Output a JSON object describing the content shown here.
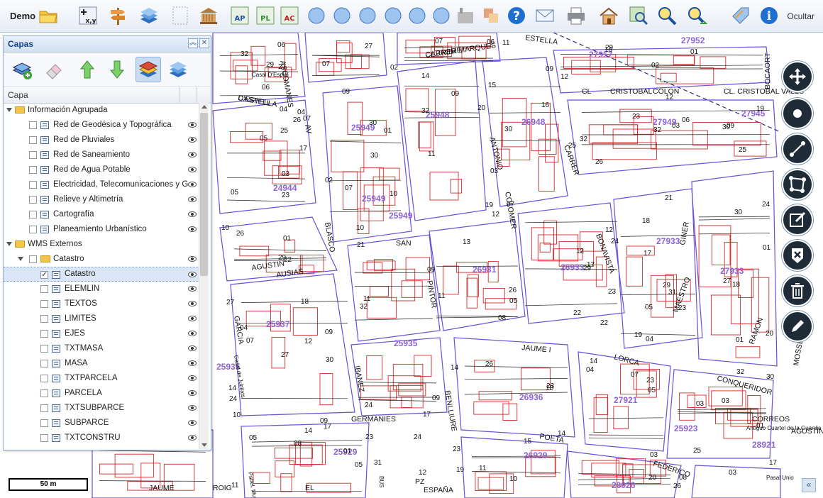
{
  "toolbar": {
    "title": "Demo",
    "hide_label": "Ocultar",
    "buttons": [
      {
        "name": "open-folder-icon"
      },
      {
        "name": "coordinates-icon",
        "text": "x,y"
      },
      {
        "name": "signpost-icon"
      },
      {
        "name": "layers-icon"
      },
      {
        "name": "blank-icon"
      },
      {
        "name": "building-icon"
      },
      {
        "name": "measure-ap-icon",
        "text": "AP"
      },
      {
        "name": "measure-pl-icon",
        "text": "PL"
      },
      {
        "name": "measure-ac-icon",
        "text": "AC"
      },
      {
        "name": "add-point-icon"
      },
      {
        "name": "add-line-icon"
      },
      {
        "name": "add-i-icon"
      },
      {
        "name": "add-v-icon"
      },
      {
        "name": "add-c-icon"
      },
      {
        "name": "add-u-icon"
      },
      {
        "name": "factory-icon"
      },
      {
        "name": "overlay-icon"
      },
      {
        "name": "help-icon"
      },
      {
        "name": "mail-icon"
      },
      {
        "name": "print-icon"
      },
      {
        "name": "home-icon"
      },
      {
        "name": "zoom-extent-icon"
      },
      {
        "name": "zoom-in-icon"
      },
      {
        "name": "zoom-next-icon"
      },
      {
        "name": "tag-icon"
      },
      {
        "name": "info-icon"
      }
    ]
  },
  "panel": {
    "title": "Capas",
    "column_header": "Capa",
    "groups": [
      {
        "label": "Información Agrupada",
        "children": [
          {
            "label": "Red de Geodésica y Topográfica",
            "checked": false
          },
          {
            "label": "Red de Pluviales",
            "checked": false
          },
          {
            "label": "Red de Saneamiento",
            "checked": false
          },
          {
            "label": "Red de Agua Potable",
            "checked": false
          },
          {
            "label": "Electricidad, Telecomunicaciones y G",
            "checked": false
          },
          {
            "label": "Relieve y Altimetría",
            "checked": false
          },
          {
            "label": "Cartografía",
            "checked": false
          },
          {
            "label": "Planeamiento Urbanístico",
            "checked": false
          }
        ]
      },
      {
        "label": "WMS Externos",
        "subgroup": "Catastro",
        "children": [
          {
            "label": "Catastro",
            "checked": true
          },
          {
            "label": "ELEMLIN",
            "checked": false
          },
          {
            "label": "TEXTOS",
            "checked": false
          },
          {
            "label": "LIMITES",
            "checked": false
          },
          {
            "label": "EJES",
            "checked": false
          },
          {
            "label": "TXTMASA",
            "checked": false
          },
          {
            "label": "MASA",
            "checked": false
          },
          {
            "label": "TXTPARCELA",
            "checked": false
          },
          {
            "label": "PARCELA",
            "checked": false
          },
          {
            "label": "TXTSUBPARCE",
            "checked": false
          },
          {
            "label": "SUBPARCE",
            "checked": false
          },
          {
            "label": "TXTCONSTRU",
            "checked": false
          }
        ]
      }
    ]
  },
  "map": {
    "scale_label": "50 m",
    "street_labels": [
      "CARRER MARQUES",
      "D'ESTELLA",
      "ESTELLA",
      "ASCOMANES",
      "CL",
      "CRISTOBAL",
      "COLON",
      "CL. CRISTOBAL VALLS",
      "BOCAORT",
      "AGUSTIN",
      "SAN",
      "BLASCO",
      "ANTONIO",
      "COLOMER",
      "CARRER",
      "AV",
      "JAUME I",
      "BONAVISTA",
      "GINER",
      "MAESTRO",
      "RAMON",
      "MOSSEN",
      "CONQUERIDOR",
      "CORREOS",
      "PINTOR",
      "BENLLIURE",
      "IBANEZ",
      "GERMANIES",
      "POETA",
      "FEDERICO",
      "PZ",
      "ESPAÑA",
      "JAUME",
      "ROIG",
      "GARCIA",
      "LORCA",
      "AUSIAS",
      "EL",
      "AGUSTÍN",
      "CL JAUME",
      "CASTELL"
    ],
    "block_numbers": [
      "27957",
      "27952",
      "25948",
      "26948",
      "25949",
      "27949",
      "27945",
      "24944",
      "25949",
      "25949",
      "27933",
      "26931",
      "26933",
      "27933",
      "25937",
      "25935",
      "26936",
      "27921",
      "25923",
      "28921",
      "25929",
      "26929",
      "28928",
      "25935"
    ],
    "parcel_numbers": [
      "01",
      "02",
      "03",
      "04",
      "05",
      "06",
      "07",
      "08",
      "09",
      "10",
      "11",
      "12",
      "13",
      "14",
      "15",
      "16",
      "17",
      "18",
      "19",
      "20",
      "21",
      "22",
      "23",
      "24",
      "25",
      "26",
      "27",
      "28",
      "29",
      "30",
      "31",
      "32"
    ],
    "annotations": [
      "Casal D'Esplai",
      "Pabel. Munic",
      "Casal de Jubilats",
      "Antiguo Cuartel de la Guardia Civil",
      "Pasal Unio",
      "BUS"
    ]
  },
  "right_tools": [
    {
      "name": "pan-tool-icon"
    },
    {
      "name": "point-tool-icon"
    },
    {
      "name": "line-tool-icon"
    },
    {
      "name": "polygon-tool-icon"
    },
    {
      "name": "edit-tool-icon"
    },
    {
      "name": "delete-vertex-icon"
    },
    {
      "name": "trash-icon"
    },
    {
      "name": "pencil-icon"
    }
  ]
}
